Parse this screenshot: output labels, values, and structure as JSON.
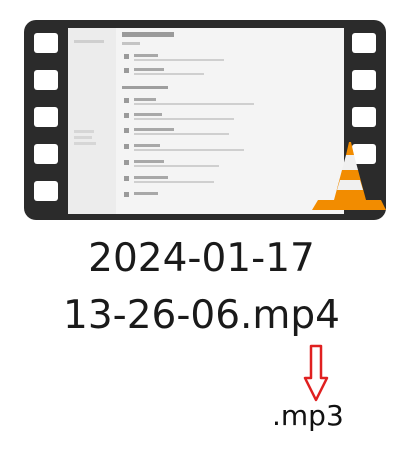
{
  "file": {
    "name_line1": "2024-01-17",
    "name_line2": "13-26-06.mp4",
    "thumbnail_icon": "video-film-icon",
    "badge_icon": "vlc-cone-icon"
  },
  "annotation": {
    "arrow_icon": "arrow-down-icon",
    "arrow_color": "#e02020",
    "new_extension": ".mp3"
  },
  "colors": {
    "film_frame": "#2b2b2b",
    "vlc_orange": "#f28c00"
  }
}
